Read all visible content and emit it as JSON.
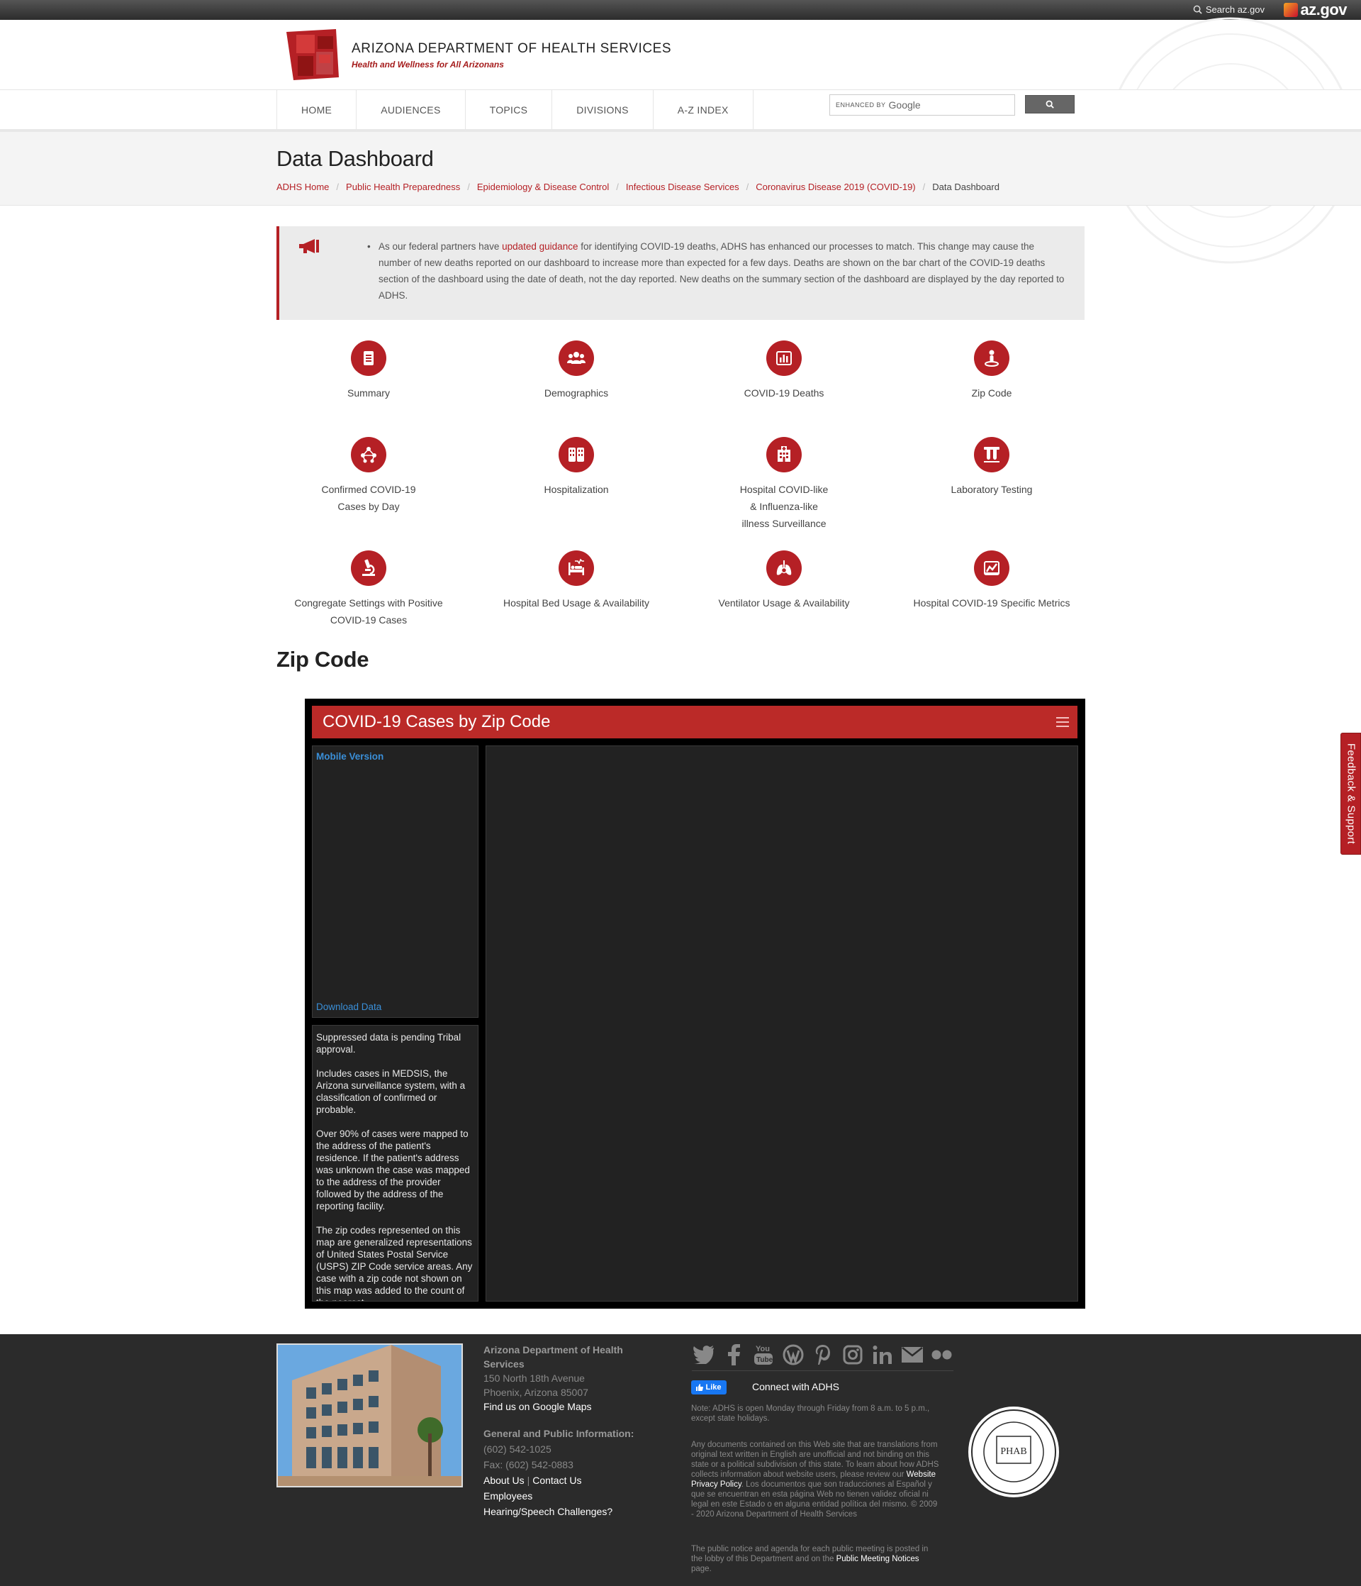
{
  "topbar": {
    "search_label": "Search az.gov",
    "brand": "az.gov"
  },
  "header": {
    "title": "ARIZONA DEPARTMENT OF HEALTH SERVICES",
    "tagline": "Health and Wellness for All Arizonans"
  },
  "nav": {
    "items": [
      "HOME",
      "AUDIENCES",
      "TOPICS",
      "DIVISIONS",
      "A-Z INDEX"
    ],
    "search_enhanced": "ENHANCED BY",
    "search_brand": "Google"
  },
  "page": {
    "title": "Data Dashboard",
    "breadcrumb": [
      "ADHS Home",
      "Public Health Preparedness",
      "Epidemiology & Disease Control",
      "Infectious Disease Services",
      "Coronavirus Disease 2019 (COVID-19)"
    ],
    "breadcrumb_current": "Data Dashboard"
  },
  "notice": {
    "pre": "As our federal partners have ",
    "link": "updated guidance",
    "post": " for identifying COVID-19 deaths, ADHS has enhanced our processes to match. This change may cause the number of new deaths reported on our dashboard to increase more than expected for a few days. Deaths are shown on the bar chart of the COVID-19 deaths section of the dashboard using the date of death, not the day reported. New deaths on the summary section of the dashboard are displayed by the day reported to ADHS."
  },
  "tiles": [
    {
      "label": "Summary",
      "icon": "document-icon"
    },
    {
      "label": "Demographics",
      "icon": "people-icon"
    },
    {
      "label": "COVID-19 Deaths",
      "icon": "bar-chart-icon"
    },
    {
      "label": "Zip Code",
      "icon": "location-pin-icon"
    },
    {
      "label": "Confirmed COVID-19\nCases by Day",
      "icon": "network-icon"
    },
    {
      "label": "Hospitalization",
      "icon": "buildings-icon"
    },
    {
      "label": "Hospital COVID-like\n& Influenza-like\nillness Surveillance",
      "icon": "hospital-icon"
    },
    {
      "label": "Laboratory Testing",
      "icon": "test-tubes-icon"
    },
    {
      "label": "Congregate Settings with Positive\nCOVID-19 Cases",
      "icon": "microscope-icon"
    },
    {
      "label": "Hospital Bed Usage & Availability",
      "icon": "hospital-bed-icon"
    },
    {
      "label": "Ventilator Usage & Availability",
      "icon": "lungs-icon"
    },
    {
      "label": "Hospital COVID-19 Specific Metrics",
      "icon": "trend-chart-icon"
    }
  ],
  "section_title": "Zip Code",
  "dashboard": {
    "title": "COVID-19 Cases by Zip Code",
    "mobile_link": "Mobile Version",
    "download_link": "Download Data",
    "notes": [
      "Suppressed data is pending Tribal approval.",
      "Includes cases in MEDSIS, the Arizona surveillance system, with a classification of confirmed or probable.",
      "Over 90% of cases were mapped to the address of the patient's residence.  If the patient's address was unknown the case was mapped to the address of the provider followed by the address of the reporting facility.",
      "The zip codes represented on this map are generalized representations of United States Postal Service (USPS) ZIP Code service areas. Any case with a zip code not shown on this map was added to the count of the nearest"
    ]
  },
  "feedback": "Feedback & Support",
  "footer": {
    "org": "Arizona Department of Health Services",
    "address1": "150 North 18th Avenue",
    "address2": "Phoenix, Arizona 85007",
    "maps_link": "Find us on Google Maps",
    "info_head": "General and Public Information:",
    "phone": "(602) 542-1025",
    "fax": "Fax: (602) 542-0883",
    "about": "About Us",
    "contact": "Contact Us",
    "employees": "Employees",
    "hearing": "Hearing/Speech Challenges?",
    "like": "Like",
    "connect": "Connect with ADHS",
    "note_hours": "Note: ADHS is open Monday through Friday from 8 a.m. to 5 p.m., except state holidays.",
    "note_translation_pre": "Any documents contained on this Web site that are translations from original text written in English are unofficial and not binding on this state or a political subdivision of this state. To learn about how ADHS collects information about website users, please review our ",
    "note_translation_link": "Website Privacy Policy",
    "note_translation_post": ". Los documentos que son traducciones al Español y que se encuentran en esta página Web no tienen validez oficial ni legal en este Estado o en alguna entidad política del mismo. © 2009 - 2020 Arizona Department of Health Services",
    "note_meetings_pre": "The public notice and agenda for each public meeting is posted in the lobby of this Department and on the ",
    "note_meetings_link": "Public Meeting Notices",
    "note_meetings_post": " page.",
    "phab": "PHAB"
  },
  "colors": {
    "brand_red": "#b52025",
    "dash_header": "#bb2a28",
    "link_blue": "#3a8fd8",
    "footer_bg": "#2b2b2b"
  }
}
